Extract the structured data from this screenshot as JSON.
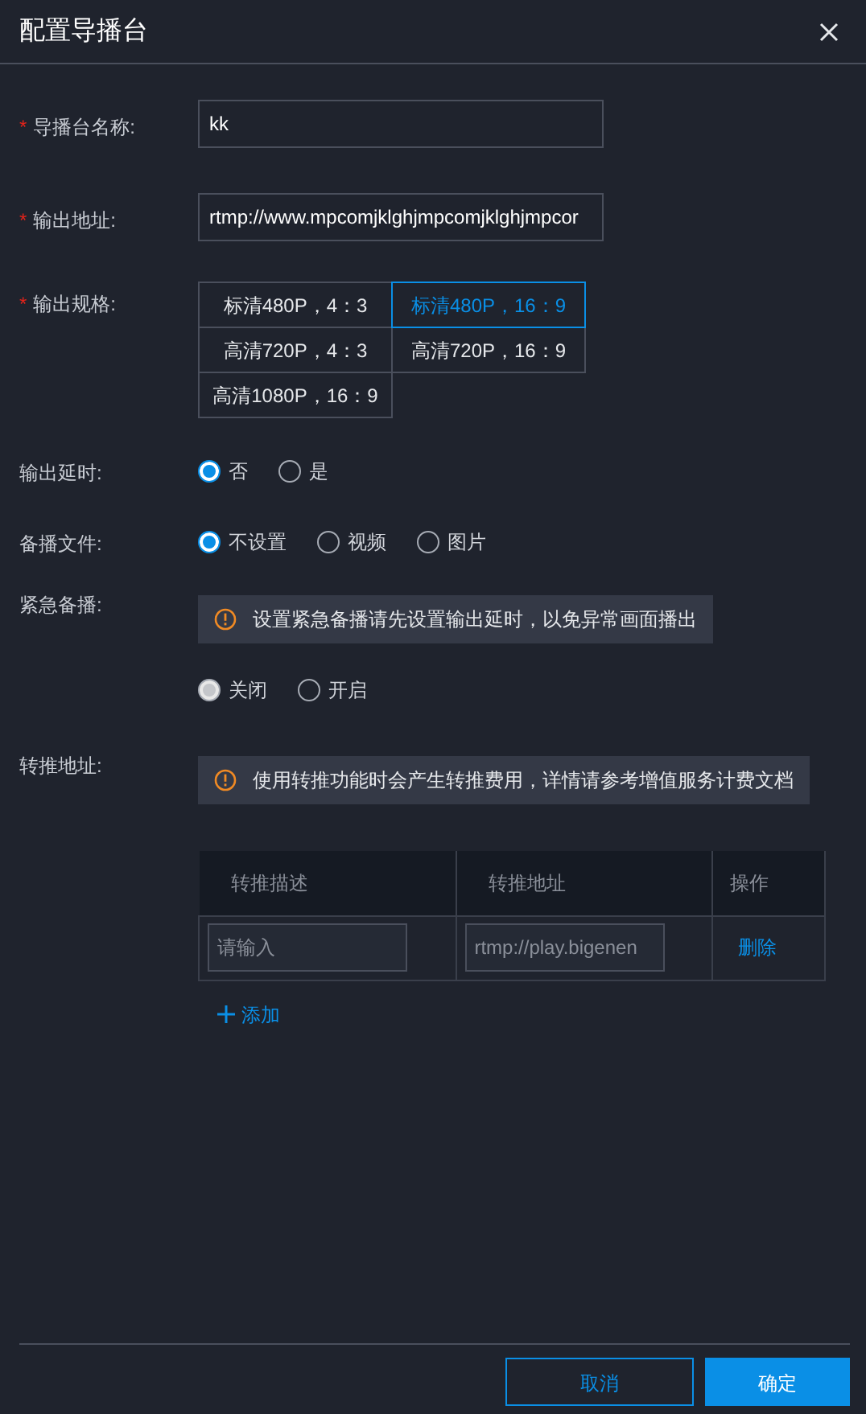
{
  "dialog": {
    "title": "配置导播台"
  },
  "name_field": {
    "label": "导播台名称:",
    "required_mark": "*",
    "value": "kk"
  },
  "address_field": {
    "label": "输出地址:",
    "required_mark": "*",
    "value": "rtmp://www.mpcomjklghjmpcomjklghjmpcor"
  },
  "spec": {
    "label": "输出规格:",
    "required_mark": "*",
    "options": [
      {
        "label": "标清480P，4：3",
        "selected": false
      },
      {
        "label": "标清480P，16：9",
        "selected": true
      },
      {
        "label": "高清720P，4：3",
        "selected": false
      },
      {
        "label": "高清720P，16：9",
        "selected": false
      },
      {
        "label": "高清1080P，16：9",
        "selected": false
      }
    ]
  },
  "output_delay": {
    "label": "输出延时:",
    "disabled": false,
    "options": [
      {
        "label": "否",
        "selected": true
      },
      {
        "label": "是",
        "selected": false
      }
    ]
  },
  "backup_file": {
    "label": "备播文件:",
    "disabled": false,
    "options": [
      {
        "label": "不设置",
        "selected": true
      },
      {
        "label": "视频",
        "selected": false
      },
      {
        "label": "图片",
        "selected": false
      }
    ]
  },
  "emergency": {
    "label": "紧急备播:",
    "notice": "设置紧急备播请先设置输出延时，以免异常画面播出",
    "disabled": true,
    "options": [
      {
        "label": "关闭",
        "selected": true
      },
      {
        "label": "开启",
        "selected": false
      }
    ]
  },
  "relay": {
    "label": "转推地址:",
    "notice": "使用转推功能时会产生转推费用，详情请参考增值服务计费文档",
    "table": {
      "columns": [
        "转推描述",
        "转推地址",
        "操作"
      ],
      "rows": [
        {
          "description": {
            "placeholder": "请输入"
          },
          "address": {
            "placeholder": "rtmp://play.bigenen"
          },
          "action": "删除"
        }
      ]
    },
    "add_link": "添加"
  },
  "buttons": [
    {
      "label": "取消",
      "kind": "secondary"
    },
    {
      "label": "确定",
      "kind": "primary"
    }
  ]
}
